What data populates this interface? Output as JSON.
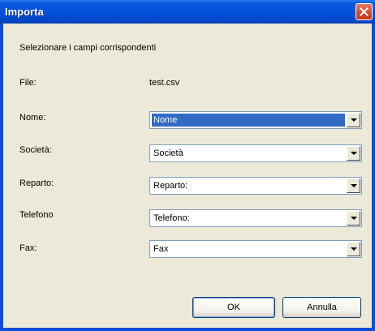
{
  "window": {
    "title": "Importa"
  },
  "dialog": {
    "instruction": "Selezionare i campi corrispondenti",
    "file_label": "File:",
    "file_value": "test.csv",
    "fields": [
      {
        "label": "Nome:",
        "value": "Nome"
      },
      {
        "label": "Società:",
        "value": "Società"
      },
      {
        "label": "Reparto:",
        "value": "Reparto:"
      },
      {
        "label": "Telefono",
        "value": "Telefono:"
      },
      {
        "label": "Fax:",
        "value": "Fax"
      }
    ],
    "ok_label": "OK",
    "cancel_label": "Annulla"
  },
  "icons": {
    "close": "close-icon",
    "dropdown": "chevron-down-icon"
  },
  "colors": {
    "titlebar": "#0451d9",
    "client_bg": "#ece9d8",
    "selection": "#316ac5",
    "close_button": "#d24a2c"
  }
}
